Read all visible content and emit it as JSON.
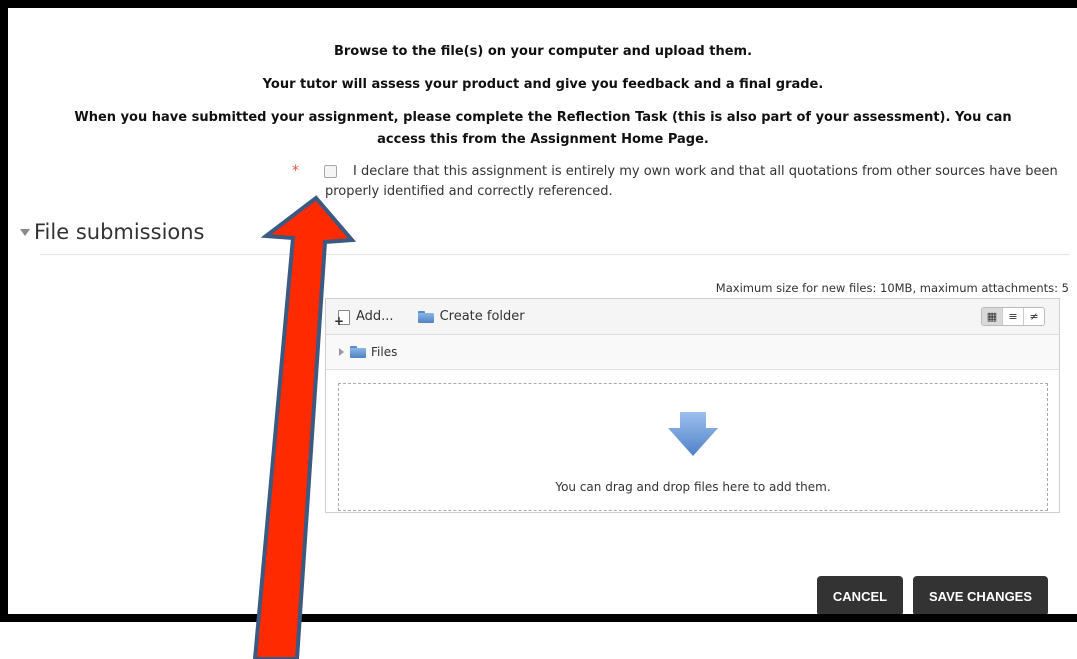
{
  "instructions": {
    "line1": "Browse to the file(s) on your computer and upload them.",
    "line2": "Your tutor will assess your product and give you feedback and a final grade.",
    "line3a": "When you have submitted your assignment, please complete the Reflection Task (this is also part of your assessment). You can",
    "line3b": "access this from the Assignment Home Page."
  },
  "declaration": {
    "required_marker": "*",
    "text": "I declare that this assignment is entirely my own work and that all quotations from other sources have been properly identified and correctly referenced.",
    "checked": false
  },
  "file_submissions": {
    "title": "File submissions",
    "max_size_text": "Maximum size for new files: 10MB, maximum attachments: 5",
    "toolbar": {
      "add_label": "Add...",
      "create_folder_label": "Create folder"
    },
    "path_label": "Files",
    "dropzone_text": "You can drag and drop files here to add them."
  },
  "buttons": {
    "cancel": "CANCEL",
    "save": "SAVE CHANGES"
  },
  "colors": {
    "accent_red": "#ff2a00",
    "arrow_outline": "#3b5a82",
    "button_bg": "#333333",
    "required": "#d9534f"
  }
}
